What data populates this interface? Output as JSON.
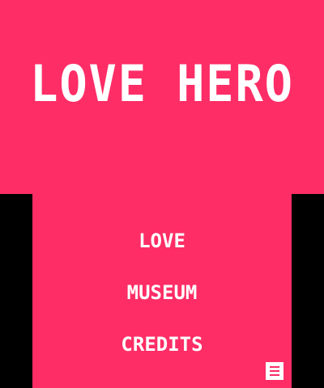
{
  "title": "LOVE HERO",
  "menu": {
    "love_label": "LOVE",
    "museum_label": "MUSEUM",
    "credits_label": "CREDITS"
  },
  "icons": {
    "corner_button": "hamburger-menu-icon"
  },
  "colors": {
    "background": "#fe2d66",
    "text": "#ffffff",
    "frame": "#000000"
  }
}
